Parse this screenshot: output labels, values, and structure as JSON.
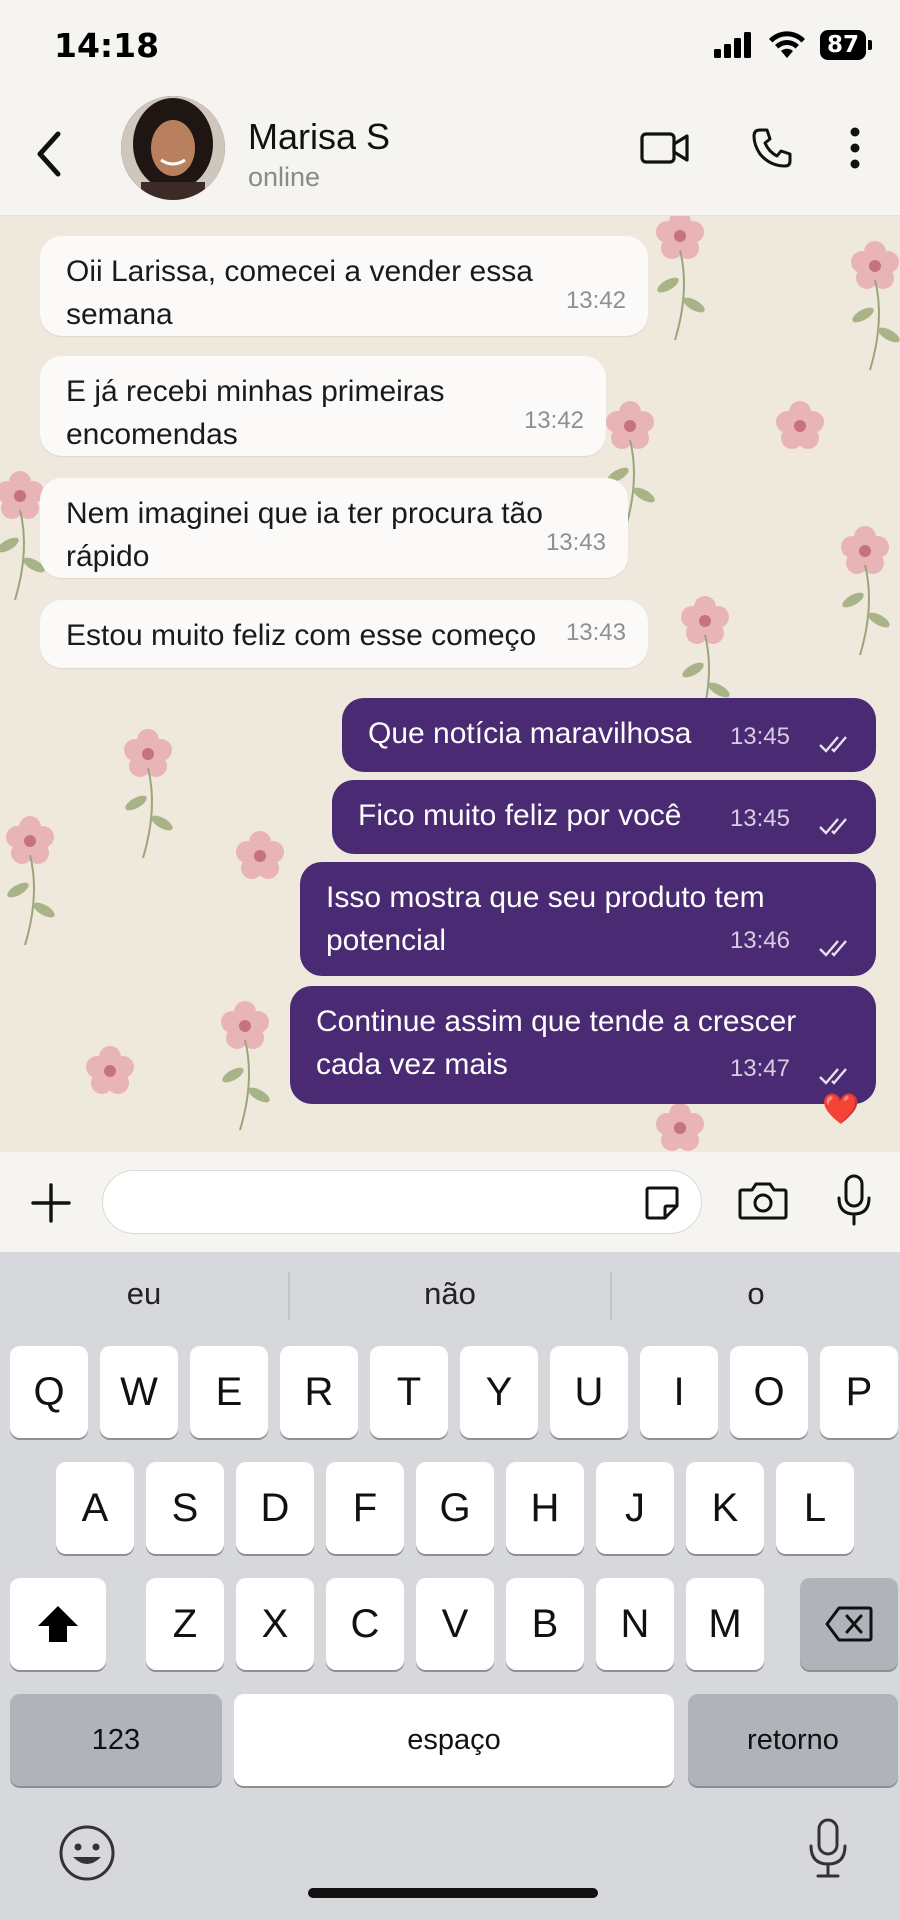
{
  "status_bar": {
    "time": "14:18",
    "battery": "87"
  },
  "header": {
    "contact_name": "Marisa S",
    "contact_status": "online"
  },
  "messages": [
    {
      "line1": "Oii Larissa, comecei a vender essa",
      "line2": "semana",
      "time": "13:42"
    },
    {
      "line1": "E já recebi minhas primeiras",
      "line2": "encomendas",
      "time": "13:42"
    },
    {
      "line1": "Nem imaginei que ia ter procura tão",
      "line2": "rápido",
      "time": "13:43"
    },
    {
      "line1": "Estou muito feliz com esse começo",
      "time": "13:43"
    },
    {
      "line1": "Que notícia maravilhosa",
      "time": "13:45"
    },
    {
      "line1": "Fico muito feliz por você",
      "time": "13:45"
    },
    {
      "line1": "Isso mostra que seu produto tem",
      "line2": "potencial",
      "time": "13:46"
    },
    {
      "line1": "Continue assim que tende a crescer",
      "line2": "cada vez mais",
      "time": "13:47"
    }
  ],
  "reaction": "❤️",
  "input": {
    "placeholder": ""
  },
  "keyboard": {
    "suggestions": [
      "eu",
      "não",
      "o"
    ],
    "row1": [
      "Q",
      "W",
      "E",
      "R",
      "T",
      "Y",
      "U",
      "I",
      "O",
      "P"
    ],
    "row2": [
      "A",
      "S",
      "D",
      "F",
      "G",
      "H",
      "J",
      "K",
      "L"
    ],
    "row3": [
      "Z",
      "X",
      "C",
      "V",
      "B",
      "N",
      "M"
    ],
    "numbers_key": "123",
    "space_key": "espaço",
    "return_key": "retorno"
  },
  "icons": {
    "back": "chevron-left-icon",
    "video": "video-icon",
    "call": "phone-icon",
    "more": "more-vertical-icon",
    "attach": "plus-icon",
    "sticker": "sticker-icon",
    "camera": "camera-icon",
    "mic": "mic-icon",
    "shift": "shift-icon",
    "backspace": "backspace-icon",
    "emoji": "emoji-icon",
    "dictation": "dictation-mic-icon"
  },
  "colors": {
    "outgoing_bubble": "#4a2a73",
    "incoming_bubble": "#fbfaf8",
    "wallpaper": "#efe8dc"
  }
}
